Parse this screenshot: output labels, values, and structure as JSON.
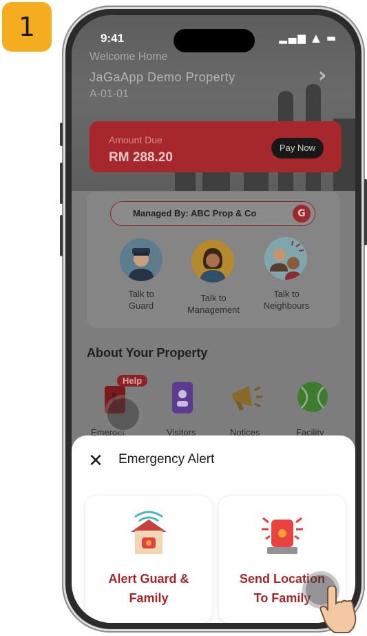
{
  "step": {
    "number": "1"
  },
  "status_bar": {
    "time": "9:41",
    "icons": "▂▄▆ ▲ ▬"
  },
  "header": {
    "welcome": "Welcome Home",
    "property": "JaGaApp Demo Property",
    "unit": "A-01-01"
  },
  "amount_due": {
    "label": "Amount Due",
    "amount": "RM 288.20",
    "button": "Pay Now"
  },
  "management": {
    "managed_by": "Managed By: ABC Prop & Co",
    "contacts": [
      {
        "line1": "Talk to",
        "line2": "Guard"
      },
      {
        "line1": "Talk to",
        "line2": "Management"
      },
      {
        "line1": "Talk to",
        "line2": "Neighbours"
      }
    ]
  },
  "property_section": {
    "title": "About Your Property",
    "help_badge": "Help",
    "features": [
      "Emerger",
      "Visitors",
      "Notices",
      "Facility"
    ]
  },
  "emergency_sheet": {
    "title": "Emergency Alert",
    "options": [
      {
        "line1": "Alert Guard &",
        "line2": "Family",
        "icon": "house-alarm-icon"
      },
      {
        "line1": "Send Location",
        "line2": "To Family",
        "icon": "siren-icon"
      }
    ]
  },
  "colors": {
    "accent_red": "#a3262b",
    "badge": "#f5ad1f"
  }
}
